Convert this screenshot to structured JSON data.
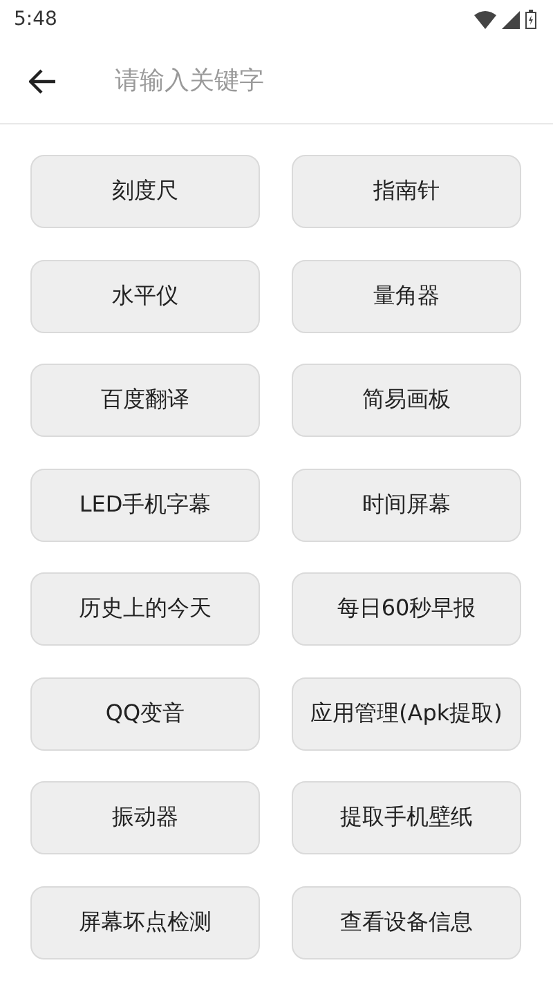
{
  "status_bar": {
    "time": "5:48"
  },
  "search": {
    "placeholder": "请输入关键字"
  },
  "tools": [
    {
      "label": "刻度尺"
    },
    {
      "label": "指南针"
    },
    {
      "label": "水平仪"
    },
    {
      "label": "量角器"
    },
    {
      "label": "百度翻译"
    },
    {
      "label": "简易画板"
    },
    {
      "label": "LED手机字幕"
    },
    {
      "label": "时间屏幕"
    },
    {
      "label": "历史上的今天"
    },
    {
      "label": "每日60秒早报"
    },
    {
      "label": "QQ变音"
    },
    {
      "label": "应用管理(Apk提取)"
    },
    {
      "label": "振动器"
    },
    {
      "label": "提取手机壁纸"
    },
    {
      "label": "屏幕坏点检测"
    },
    {
      "label": "查看设备信息"
    }
  ]
}
